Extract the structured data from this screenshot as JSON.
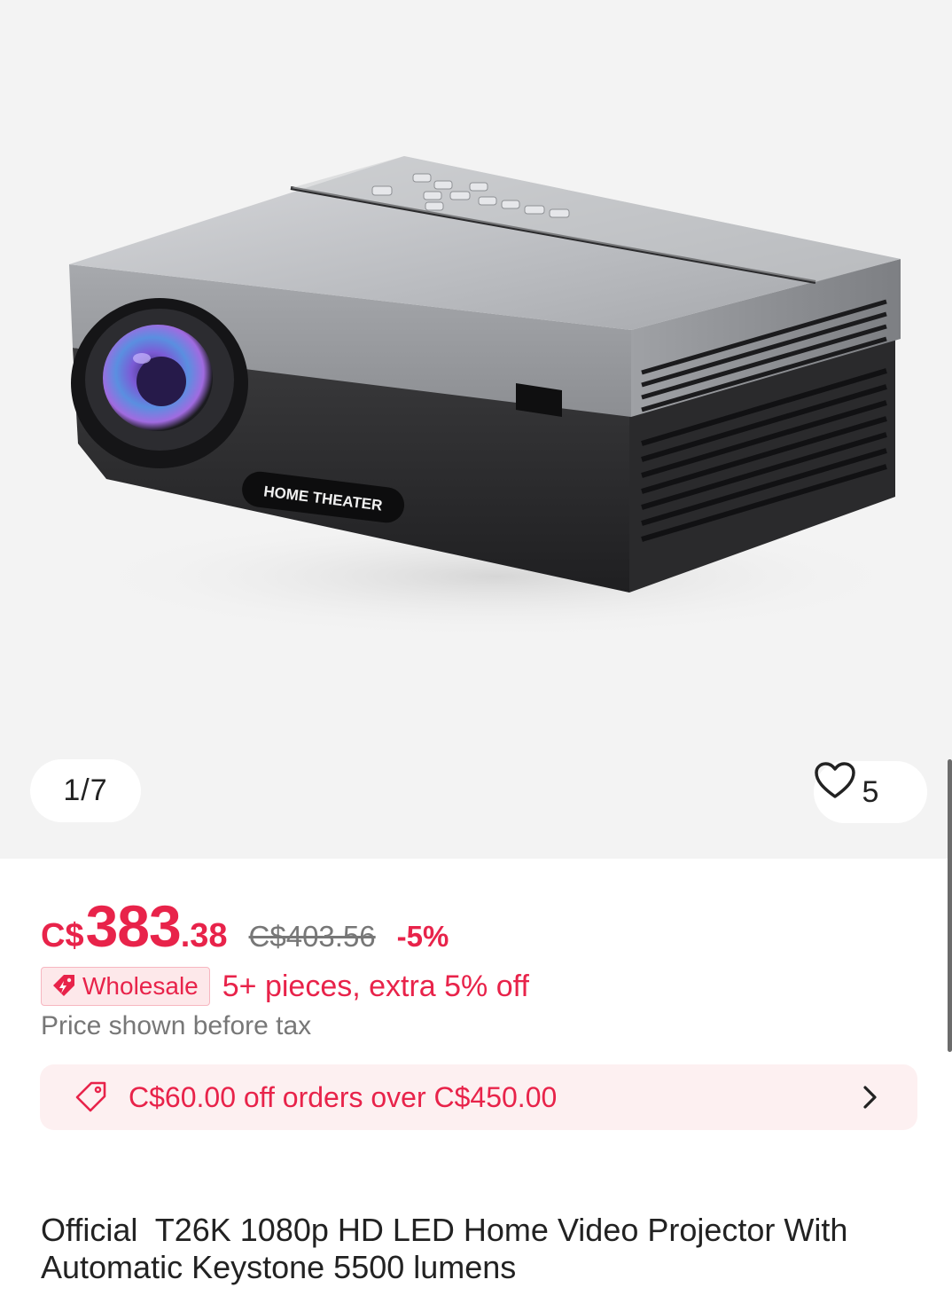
{
  "gallery": {
    "product_label": "HOME THEATER",
    "counter": "1/7",
    "favorites_count": "5",
    "favorite_icon": "heart-outline-icon"
  },
  "price": {
    "currency": "C$",
    "integer": "383",
    "decimal": ".38",
    "original": "C$403.56",
    "discount": "-5%"
  },
  "wholesale": {
    "badge_label": "Wholesale",
    "badge_icon": "tag-bolt-icon",
    "offer": "5+ pieces, extra 5% off"
  },
  "tax_note": "Price shown before tax",
  "coupon": {
    "icon": "coupon-tag-icon",
    "text": "C$60.00 off orders over C$450.00",
    "chevron": "chevron-right-icon"
  },
  "product": {
    "title": "Official  T26K 1080p HD LED Home Video Projector With Automatic Keystone 5500 lumens"
  },
  "colors": {
    "accent": "#e8234a",
    "coupon_bg": "#fdf0f1",
    "gallery_bg": "#f3f3f3"
  }
}
